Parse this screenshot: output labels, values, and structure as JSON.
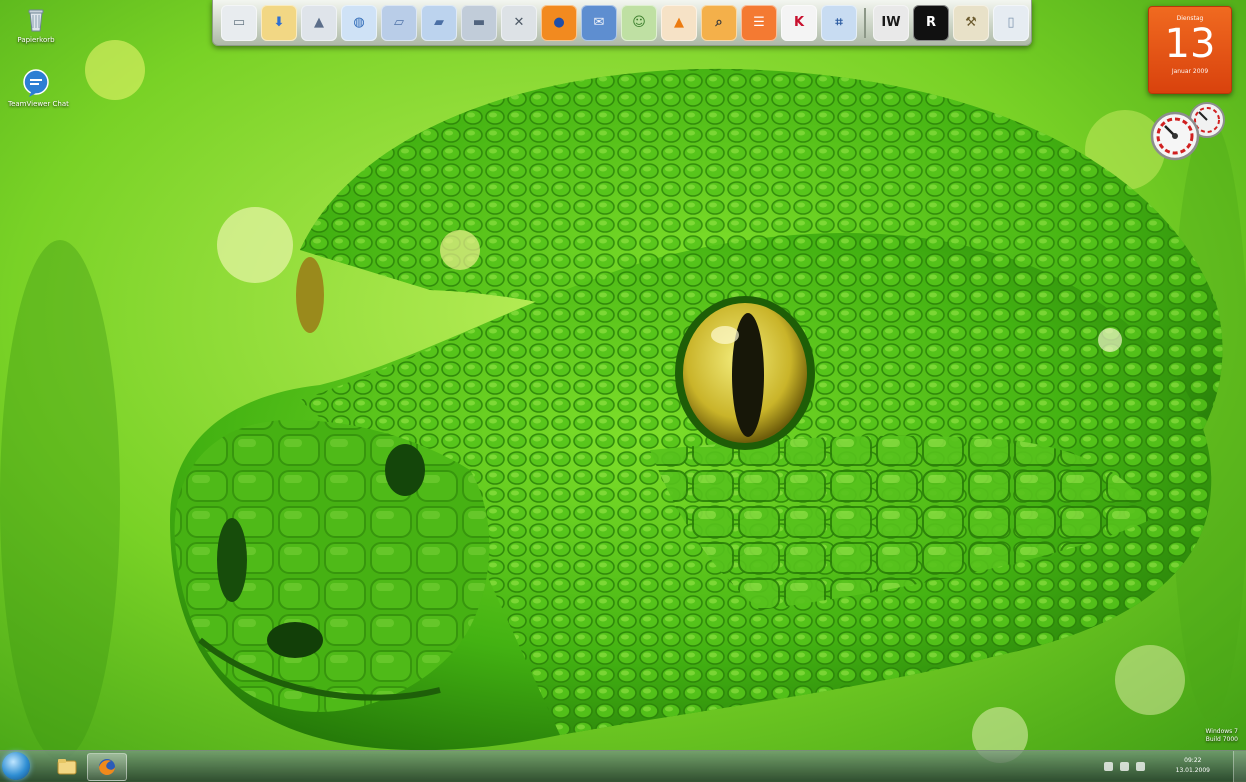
{
  "desktop": {
    "icons": [
      {
        "label": "Papierkorb",
        "icon": "recycle-bin-icon"
      },
      {
        "label": "TeamViewer Chat",
        "icon": "chat-bubble-icon"
      }
    ],
    "wallpaper": "green-tree-python-closeup"
  },
  "dock": {
    "icons": [
      {
        "name": "computer-icon",
        "bg": "#e8ecef",
        "fg": "#6a7a86",
        "glyph": "▭"
      },
      {
        "name": "downloads-folder-icon",
        "bg": "#f2d784",
        "fg": "#2f6fd1",
        "glyph": "⬇"
      },
      {
        "name": "rocket-icon",
        "bg": "#dfe4ea",
        "fg": "#5c6e8a",
        "glyph": "▲"
      },
      {
        "name": "network-globe-icon",
        "bg": "#cfe2f6",
        "fg": "#2b67b5",
        "glyph": "◍"
      },
      {
        "name": "folder-icon",
        "bg": "#b9cde8",
        "fg": "#4f73a8",
        "glyph": "▱"
      },
      {
        "name": "open-folder-icon",
        "bg": "#bcd3ee",
        "fg": "#4b6fa5",
        "glyph": "▰"
      },
      {
        "name": "drive-icon",
        "bg": "#c1ccd9",
        "fg": "#51647f",
        "glyph": "▬"
      },
      {
        "name": "tools-icon",
        "bg": "#dde2e6",
        "fg": "#4d5966",
        "glyph": "✕"
      },
      {
        "name": "firefox-icon",
        "bg": "#f28a1f",
        "fg": "#1f4ea8",
        "glyph": "●"
      },
      {
        "name": "thunderbird-icon",
        "bg": "#5e8ed0",
        "fg": "#f4f6fa",
        "glyph": "✉"
      },
      {
        "name": "contacts-icon",
        "bg": "#bfe0a3",
        "fg": "#3b7d2c",
        "glyph": "☺"
      },
      {
        "name": "vlc-icon",
        "bg": "#f6e2c6",
        "fg": "#ec7b10",
        "glyph": "▲"
      },
      {
        "name": "search-icon",
        "bg": "#f4b04a",
        "fg": "#3a3a3a",
        "glyph": "⌕"
      },
      {
        "name": "menu-list-icon",
        "bg": "#f47a32",
        "fg": "#ffffff",
        "glyph": "☰"
      },
      {
        "name": "kaspersky-k-icon",
        "bg": "#f4f4f4",
        "fg": "#c8102e",
        "glyph": "K"
      },
      {
        "name": "registry-editor-icon",
        "bg": "#c8dcf2",
        "fg": "#2a5aa0",
        "glyph": "⌗"
      },
      {
        "name": "iw-app-icon",
        "bg": "#e9e9e9",
        "fg": "#1a1a1a",
        "glyph": "IW"
      },
      {
        "name": "rockstar-r-icon",
        "bg": "#111111",
        "fg": "#ffffff",
        "glyph": "R"
      },
      {
        "name": "hammer-tools-icon",
        "bg": "#e8e1c8",
        "fg": "#6b5a2d",
        "glyph": "⚒"
      },
      {
        "name": "recycle-bin-icon",
        "bg": "#e6ecf2",
        "fg": "#8097b0",
        "glyph": "▯"
      }
    ]
  },
  "gadgets": {
    "calendar": {
      "weekday": "Dienstag",
      "day": "13",
      "month": "Januar 2009"
    },
    "meter": {
      "icon": "cpu-meter-icon"
    }
  },
  "taskbar": {
    "start": "windows-start-orb-icon",
    "buttons": [
      {
        "name": "explorer-icon"
      },
      {
        "name": "firefox-icon"
      }
    ],
    "clock": {
      "time": "09:22",
      "date": "13.01.2009"
    }
  },
  "watermark": {
    "line1": "Windows 7",
    "line2": "Build 7000"
  },
  "colors": {
    "calendar_orange": "#e4531a",
    "dock_bg": "#d3dbcf",
    "taskbar": "#3d5a4a"
  }
}
